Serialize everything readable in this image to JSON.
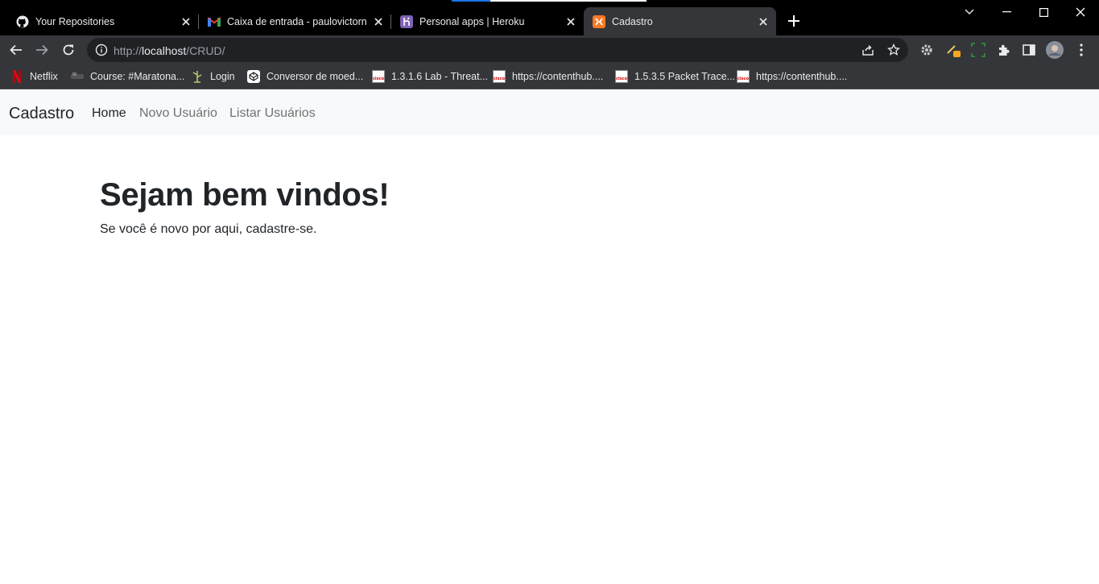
{
  "browser": {
    "tabs": [
      {
        "title": "Your Repositories",
        "icon": "github-icon"
      },
      {
        "title": "Caixa de entrada - paulovictornunes",
        "icon": "gmail-icon"
      },
      {
        "title": "Personal apps | Heroku",
        "icon": "heroku-icon"
      },
      {
        "title": "Cadastro",
        "icon": "xampp-icon",
        "active": true
      }
    ],
    "address": {
      "scheme": "http://",
      "host": "localhost",
      "path": "/CRUD/"
    },
    "bookmarks": [
      {
        "label": "Netflix",
        "icon": "netflix-icon"
      },
      {
        "label": "Course: #Maratona...",
        "icon": "course-icon"
      },
      {
        "label": "Login",
        "icon": "login-icon"
      },
      {
        "label": "Conversor de moed...",
        "icon": "codepen-icon"
      },
      {
        "label": "1.3.1.6 Lab - Threat...",
        "icon": "cisco-icon"
      },
      {
        "label": "https://contenthub....",
        "icon": "cisco-icon"
      },
      {
        "label": "1.5.3.5 Packet Trace...",
        "icon": "cisco-icon"
      },
      {
        "label": "https://contenthub....",
        "icon": "cisco-icon"
      }
    ],
    "colors": {
      "tabstrip": "#000000",
      "toolbar": "#35363a",
      "omnibox": "#202124"
    }
  },
  "page": {
    "navbar": {
      "brand": "Cadastro",
      "links": [
        "Home",
        "Novo Usuário",
        "Listar Usuários"
      ],
      "active_link": "Home"
    },
    "main": {
      "heading": "Sejam bem vindos!",
      "lead": "Se você é novo por aqui, cadastre-se."
    }
  }
}
